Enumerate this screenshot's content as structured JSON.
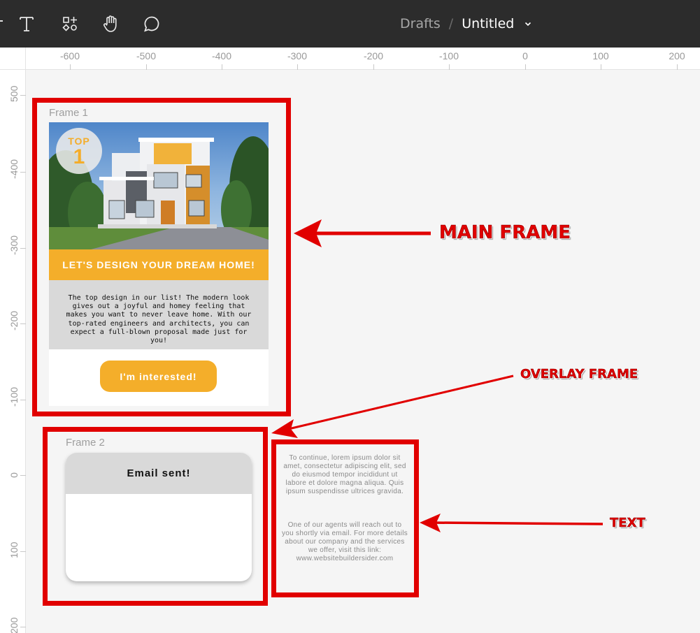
{
  "toolbar": {
    "tools": [
      "text-icon",
      "components-icon",
      "hand-icon",
      "comment-icon"
    ],
    "breadcrumb_parent": "Drafts",
    "separator": "/",
    "file_name": "Untitled"
  },
  "rulers": {
    "x_labels": [
      "-600",
      "-500",
      "-400",
      "-300",
      "-200",
      "-100",
      "0",
      "100",
      "200"
    ],
    "y_labels": [
      "500",
      "-400",
      "-300",
      "-200",
      "-100",
      "0",
      "100",
      "200"
    ]
  },
  "frame1": {
    "label": "Frame 1",
    "badge_top": "TOP",
    "badge_number": "1",
    "banner": "LET'S DESIGN YOUR DREAM HOME!",
    "description": "The top design in our list! The modern look gives out a joyful and homey feeling that makes you want to never leave home. With our top-rated engineers and architects, you can expect a full-blown proposal made just for you!",
    "button": "I'm interested!"
  },
  "frame2": {
    "label": "Frame 2",
    "title": "Email sent!"
  },
  "text_layer": {
    "paragraph1": "To continue, lorem ipsum dolor sit amet, consectetur adipiscing elit, sed do eiusmod tempor incididunt ut labore et dolore magna aliqua. Quis ipsum suspendisse ultrices gravida.",
    "paragraph2": "One of our agents will reach out to you shortly via email. For more details about our company and the services we offer, visit this link: www.websitebuildersider.com"
  },
  "annotations": {
    "main": "MAIN FRAME",
    "overlay": "OVERLAY FRAME",
    "text": "TEXT"
  },
  "colors": {
    "accent": "#f4ae2a",
    "annotation": "#e10000",
    "toolbar": "#2c2c2c"
  }
}
